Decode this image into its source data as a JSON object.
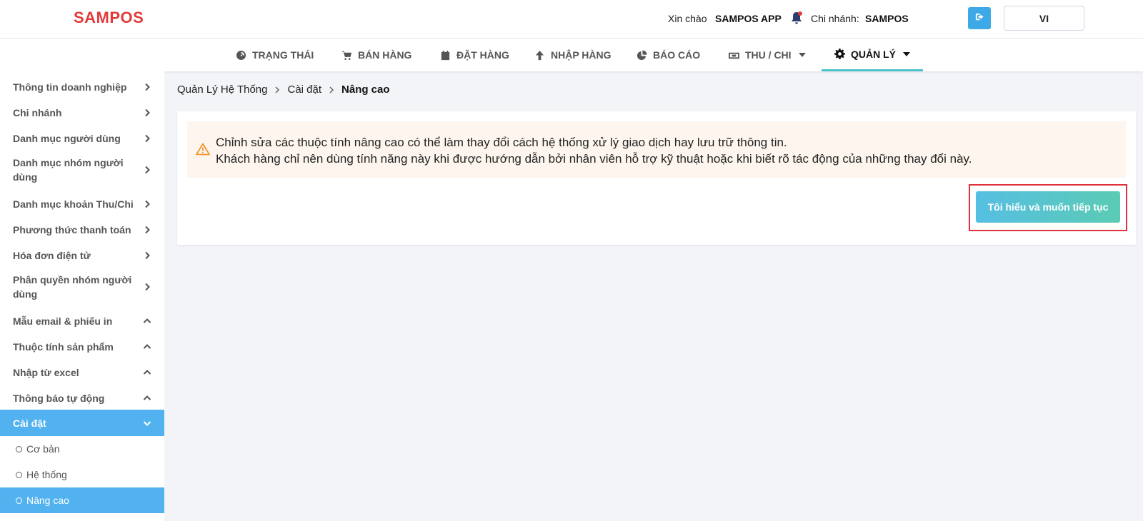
{
  "header": {
    "logo": "SAMPOS",
    "greeting_label": "Xin chào",
    "greeting_user": "SAMPOS APP",
    "branch_label": "Chi nhánh:",
    "branch_value": "SAMPOS",
    "language": "VI",
    "accent": "#3ea9e7"
  },
  "nav": {
    "items": [
      {
        "label": "TRẠNG THÁI",
        "icon": "dashboard-icon"
      },
      {
        "label": "BÁN HÀNG",
        "icon": "cart-icon"
      },
      {
        "label": "ĐẶT HÀNG",
        "icon": "calendar-icon"
      },
      {
        "label": "NHẬP HÀNG",
        "icon": "arrow-up-icon"
      },
      {
        "label": "BÁO CÁO",
        "icon": "pie-chart-icon"
      },
      {
        "label": "THU / CHI",
        "icon": "money-icon"
      },
      {
        "label": "QUẢN LÝ",
        "icon": "gear-icon"
      }
    ],
    "active": "QUẢN LÝ"
  },
  "sidebar": {
    "items": [
      {
        "label": "Thông tin doanh nghiệp"
      },
      {
        "label": "Chi nhánh"
      },
      {
        "label": "Danh mục người dùng"
      },
      {
        "label": "Danh mục nhóm người dùng"
      },
      {
        "label": "Danh mục khoản Thu/Chi"
      },
      {
        "label": "Phương thức thanh toán"
      },
      {
        "label": "Hóa đơn điện tử"
      },
      {
        "label": "Phân quyền nhóm người dùng"
      },
      {
        "label": "Mẫu email & phiếu in"
      },
      {
        "label": "Thuộc tính sản phẩm"
      },
      {
        "label": "Nhập từ excel"
      },
      {
        "label": "Thông báo tự động"
      },
      {
        "label": "Cài đặt"
      }
    ],
    "subitems": [
      {
        "label": "Cơ bản"
      },
      {
        "label": "Hệ thống"
      },
      {
        "label": "Nâng cao"
      }
    ],
    "active_color": "#51b2ef"
  },
  "breadcrumb": {
    "items": [
      "Quản Lý Hệ Thống",
      "Cài đặt",
      "Nâng cao"
    ]
  },
  "warning": {
    "line1": "Chỉnh sửa các thuộc tính nâng cao có thể làm thay đổi cách hệ thống xử lý giao dịch hay lưu trữ thông tin.",
    "line2": "Khách hàng chỉ nên dùng tính năng này khi được hướng dẫn bởi nhân viên hỗ trợ kỹ thuật hoặc khi biết rõ tác động của những thay đổi này."
  },
  "confirm_button": {
    "label": "Tôi hiểu và muốn tiếp tục"
  }
}
